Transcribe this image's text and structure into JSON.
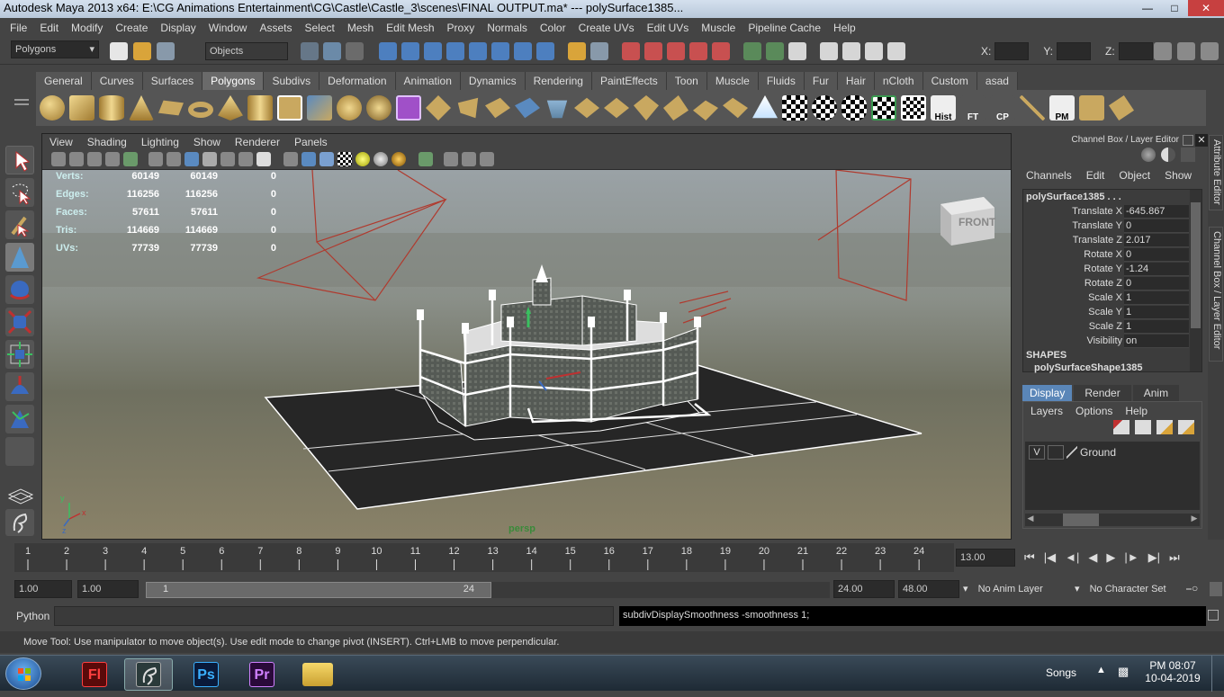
{
  "window": {
    "title": "Autodesk Maya 2013 x64: E:\\CG Animations Entertainment\\CG\\Castle\\Castle_3\\scenes\\FINAL OUTPUT.ma*    ---    polySurface1385..."
  },
  "menubar": [
    "File",
    "Edit",
    "Modify",
    "Create",
    "Display",
    "Window",
    "Assets",
    "Select",
    "Mesh",
    "Edit Mesh",
    "Proxy",
    "Normals",
    "Color",
    "Create UVs",
    "Edit UVs",
    "Muscle",
    "Pipeline Cache",
    "Help"
  ],
  "statusline": {
    "mode": "Polygons",
    "select_mode": "Objects",
    "x_label": "X:",
    "y_label": "Y:",
    "z_label": "Z:"
  },
  "shelf": {
    "tabs": [
      "General",
      "Curves",
      "Surfaces",
      "Polygons",
      "Subdivs",
      "Deformation",
      "Animation",
      "Dynamics",
      "Rendering",
      "PaintEffects",
      "Toon",
      "Muscle",
      "Fluids",
      "Fur",
      "Hair",
      "nCloth",
      "Custom",
      "asad"
    ],
    "active_tab": "Polygons",
    "labels": {
      "hist": "Hist",
      "ft": "FT",
      "cp": "CP",
      "pm": "PM"
    }
  },
  "viewport": {
    "menu": [
      "View",
      "Shading",
      "Lighting",
      "Show",
      "Renderer",
      "Panels"
    ],
    "camera": "persp",
    "viewcube_label": "FRONT",
    "hud": [
      {
        "label": "Verts:",
        "a": "60149",
        "b": "60149",
        "c": "0"
      },
      {
        "label": "Edges:",
        "a": "116256",
        "b": "116256",
        "c": "0"
      },
      {
        "label": "Faces:",
        "a": "57611",
        "b": "57611",
        "c": "0"
      },
      {
        "label": "Tris:",
        "a": "114669",
        "b": "114669",
        "c": "0"
      },
      {
        "label": "UVs:",
        "a": "77739",
        "b": "77739",
        "c": "0"
      }
    ]
  },
  "channelbox": {
    "title": "Channel Box / Layer Editor",
    "menu": [
      "Channels",
      "Edit",
      "Object",
      "Show"
    ],
    "object": "polySurface1385 . . .",
    "attrs": [
      {
        "label": "Translate X",
        "value": "-645.867"
      },
      {
        "label": "Translate Y",
        "value": "0"
      },
      {
        "label": "Translate Z",
        "value": "2.017"
      },
      {
        "label": "Rotate X",
        "value": "0"
      },
      {
        "label": "Rotate Y",
        "value": "-1.24"
      },
      {
        "label": "Rotate Z",
        "value": "0"
      },
      {
        "label": "Scale X",
        "value": "1"
      },
      {
        "label": "Scale Y",
        "value": "1"
      },
      {
        "label": "Scale Z",
        "value": "1"
      },
      {
        "label": "Visibility",
        "value": "on"
      }
    ],
    "shapes_header": "SHAPES",
    "shape_name": "polySurfaceShape1385"
  },
  "layers": {
    "tabs": [
      "Display",
      "Render",
      "Anim"
    ],
    "menu": [
      "Layers",
      "Options",
      "Help"
    ],
    "rows": [
      {
        "visible": "V",
        "name": "Ground"
      }
    ]
  },
  "sidetabs": [
    "Attribute Editor",
    "Channel Box / Layer Editor"
  ],
  "timeslider": {
    "ticks": [
      "1",
      "2",
      "3",
      "4",
      "5",
      "6",
      "7",
      "8",
      "9",
      "10",
      "11",
      "12",
      "13",
      "14",
      "15",
      "16",
      "17",
      "18",
      "19",
      "20",
      "21",
      "22",
      "23",
      "24"
    ],
    "current_frame": "13.00"
  },
  "range": {
    "start": "1.00",
    "playback_start": "1.00",
    "range_start": "1",
    "range_end": "24",
    "playback_end": "24.00",
    "end": "48.00",
    "anim_layer": "No Anim Layer",
    "character_set": "No Character Set"
  },
  "cmdline": {
    "lang": "Python",
    "result": "subdivDisplaySmoothness -smoothness 1;"
  },
  "helpline": "Move Tool: Use manipulator to move object(s). Use edit mode to change pivot (INSERT).  Ctrl+LMB to move perpendicular.",
  "taskbar": {
    "apps": [
      {
        "name": "Fl"
      },
      {
        "name": "maya"
      },
      {
        "name": "Ps"
      },
      {
        "name": "Pr"
      },
      {
        "name": "explorer"
      }
    ],
    "tray_label": "Songs",
    "time": "PM 08:07",
    "date": "10-04-2019"
  },
  "colors": {
    "accent": "#5a86b8",
    "wire": "#ffffff",
    "camera": "#b03a2e",
    "hud": "#cceeee"
  }
}
